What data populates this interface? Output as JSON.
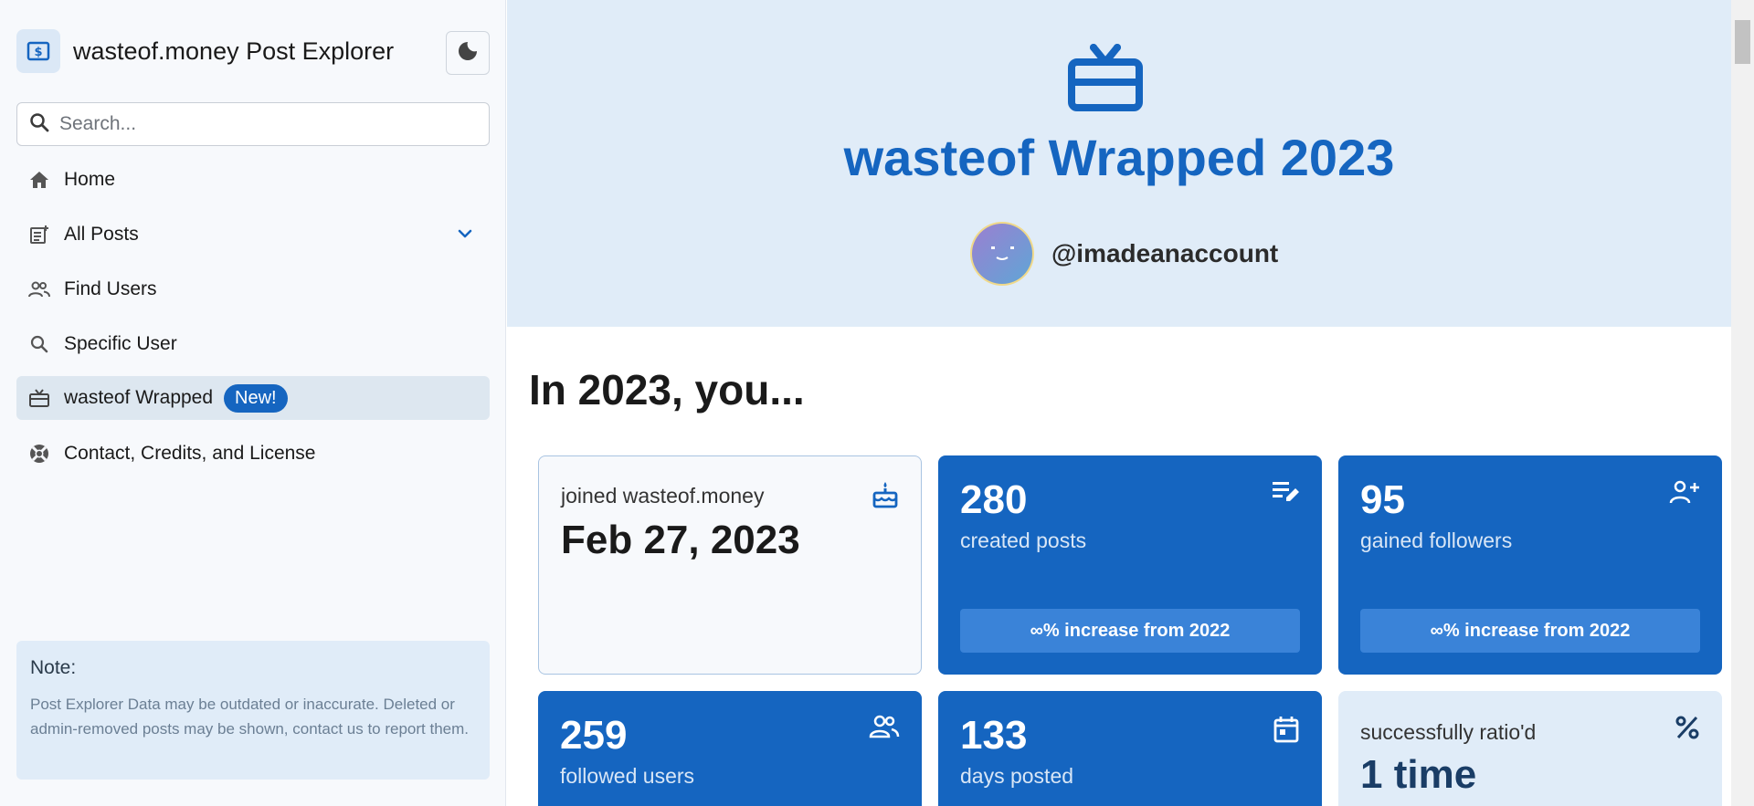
{
  "sidebar": {
    "app_title": "wasteof.money Post Explorer",
    "logo_icon": "dollar-bill-icon",
    "theme_toggle_icon": "moon-icon",
    "search": {
      "placeholder": "Search..."
    },
    "nav": [
      {
        "label": "Home",
        "icon": "home-icon"
      },
      {
        "label": "All Posts",
        "icon": "post-list-icon"
      },
      {
        "label": "Find Users",
        "icon": "users-icon"
      },
      {
        "label": "Specific User",
        "icon": "search-icon"
      },
      {
        "label": "wasteof Wrapped",
        "icon": "gift-icon",
        "badge": "New!"
      },
      {
        "label": "Contact, Credits, and License",
        "icon": "lifebuoy-icon"
      }
    ],
    "note": {
      "title": "Note:",
      "text": "Post Explorer Data may be outdated or inaccurate. Deleted or admin-removed posts may be shown, contact us to report them."
    }
  },
  "hero": {
    "title": "wasteof Wrapped 2023",
    "username": "@imadeanaccount"
  },
  "section_title": "In 2023, you...",
  "cards": {
    "joined": {
      "label": "joined wasteof.money",
      "value": "Feb 27, 2023",
      "icon": "cake-icon"
    },
    "posts": {
      "value": "280",
      "label": "created posts",
      "change": "∞% increase from 2022",
      "icon": "edit-note-icon"
    },
    "followers": {
      "value": "95",
      "label": "gained followers",
      "change": "∞% increase from 2022",
      "icon": "person-add-icon"
    },
    "following": {
      "value": "259",
      "label": "followed users",
      "icon": "people-icon"
    },
    "days": {
      "value": "133",
      "label": "days posted",
      "icon": "calendar-icon"
    },
    "ratio": {
      "label": "successfully ratio'd",
      "value": "1 time",
      "icon": "percent-icon"
    }
  },
  "colors": {
    "accent": "#1565c0",
    "hero_bg": "#e0ecf8",
    "sidebar_bg": "#f7f9fc"
  }
}
